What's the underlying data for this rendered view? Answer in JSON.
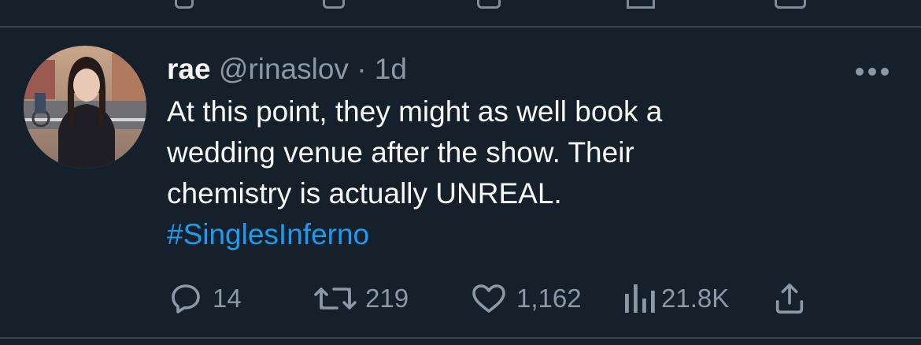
{
  "tweet": {
    "display_name": "rae",
    "handle": "@rinaslov",
    "separator": "·",
    "time": "1d",
    "text_lines": [
      "At this point, they might as well book a",
      "wedding venue after the show. Their",
      "chemistry is actually UNREAL."
    ],
    "hashtag": "#SinglesInferno",
    "avatar_icon": "profile-photo",
    "more_icon": "more-icon"
  },
  "actions": {
    "replies": "14",
    "retweets": "219",
    "likes": "1,162",
    "views": "21.8K",
    "icons": [
      "reply-icon",
      "retweet-icon",
      "like-icon",
      "views-icon",
      "share-icon"
    ]
  },
  "colors": {
    "background": "#15202b",
    "text": "#f7f9f9",
    "secondary": "#8b98a5",
    "link": "#1d9bf0",
    "divider": "#38444d"
  }
}
